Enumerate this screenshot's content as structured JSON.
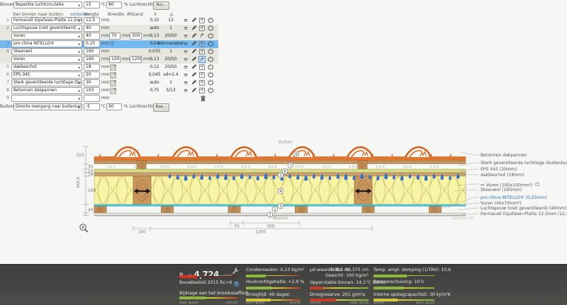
{
  "inside": {
    "label": "Binnen:",
    "condition": "Beperkte luchtcirculatie",
    "temp": "15",
    "temp_unit": "°C",
    "humidity": "80",
    "humidity_label": "% Luchtvochtigheid",
    "button": "Rsi..."
  },
  "outside": {
    "label": "Buiten:",
    "condition": "Directe overgang naar buitenlucht",
    "temp": "-5",
    "temp_unit": "°C",
    "humidity": "90",
    "humidity_label": "% Luchtvochtigheid",
    "button": "Rse..."
  },
  "table_header": {
    "direction": "Van binnen naar buiten:",
    "invert_link": "omkeren",
    "hoogte": "Hoogte",
    "breedte": "Breedte",
    "afstand": "Afstand",
    "lambda": "λ",
    "mu": "μ"
  },
  "units": {
    "mm": "mm"
  },
  "layers": [
    {
      "num": "1",
      "name": "Fermacell Gipsfaser-Platte 12,5mm",
      "hoogte": "12,5",
      "lambda": "0,32",
      "mu": "13"
    },
    {
      "num": "2",
      "name": "Luchtspouw (niet geventileerd)",
      "hoogte": "40",
      "lambda": "auto",
      "mu": "1",
      "group": true
    },
    {
      "num": "",
      "name": "Vuren",
      "hoogte": "40",
      "breedte": "70",
      "afstand": "300",
      "lambda": "0,13",
      "mu": "20/50",
      "group": true,
      "sub": true
    },
    {
      "num": "3",
      "name": "pro clima INTELLO®",
      "hoogte": "0,25",
      "lambda": "0,04",
      "mu": "sd=variabel",
      "selected": true,
      "foil": true
    },
    {
      "num": "4",
      "name": "Steenwol",
      "hoogte": "160",
      "lambda": "0,035",
      "mu": "1",
      "group": true
    },
    {
      "num": "",
      "name": "Vuren",
      "hoogte": "160",
      "breedte": "100",
      "afstand": "1200",
      "lambda": "0,13",
      "mu": "20/50",
      "group": true,
      "sub": true,
      "sub_selected": true
    },
    {
      "num": "5",
      "name": "dakbeschot",
      "hoogte": "18",
      "lambda": "0,12",
      "mu": "20/50",
      "swatch": true
    },
    {
      "num": "6",
      "name": "EPS 045",
      "hoogte": "20",
      "lambda": "0,045",
      "mu": "sd=2.4",
      "swatch": true
    },
    {
      "num": "7",
      "name": "Sterk geventileerde luchtlage (buitenlucht)",
      "hoogte": "30",
      "lambda": "auto",
      "mu": "1",
      "swatch": true
    },
    {
      "num": "8",
      "name": "Betonnen dakpannen",
      "hoogte": "103",
      "lambda": "0,75",
      "mu": "5/13",
      "swatch": true
    },
    {
      "num": "9",
      "name": "",
      "hoogte": "",
      "empty": true
    }
  ],
  "diagram": {
    "buiten": "Buiten",
    "binnen": "Binnen",
    "watermark": "ubakus.de",
    "total_thickness": "383,8",
    "dims_left": [
      "103",
      "30",
      "20",
      "18",
      "160",
      "40"
    ],
    "dims_top_row": [
      "70",
      "300"
    ],
    "dims_bottom_row": [
      "100",
      "1200"
    ],
    "markers": [
      "1",
      "2",
      "3",
      "4",
      "5",
      "6",
      "7",
      "8"
    ],
    "legend": [
      {
        "label": "Betonnen dakpannen"
      },
      {
        "label": "Sterk geventileerde luchtlage (buitenlucht) (30mm)"
      },
      {
        "label": "EPS 045 (20mm)"
      },
      {
        "label": "dakbeschot (18mm)"
      },
      {
        "label": "Vuren (160x100mm²)",
        "prefix": "↔",
        "power": true
      },
      {
        "label": "Steenwol (160mm)"
      },
      {
        "label": "pro clima INTELLO® (0,25mm)",
        "color": "#2a6ebb"
      },
      {
        "label": "Vuren (40x70mm²)"
      },
      {
        "label": "Luchtspouw (niet geventileerd) (40mm)"
      },
      {
        "label": "Fermacell Gipsfaser-Platte 12,5mm (12,5mm)"
      }
    ]
  },
  "footer": {
    "rc_sym": "R",
    "rc_sub": "c",
    "rc_eq": " = ",
    "rc_value": "4,724",
    "rc_unit": " m²K/W",
    "rc_bar": {
      "fill": 30,
      "color": "#dd2f1e",
      "track": "#5e2e28"
    },
    "bouwbesluit": "Bouwbesluit 2015 Rc>6",
    "info_glyph": "?",
    "col_a_metric": {
      "label": "Bijdrage aan het broeikaseffect",
      "fill": 45,
      "color": "#8db83e"
    },
    "col_b": [
      {
        "label": "Condenswater: 0,23 kg/m²",
        "fill": 36,
        "color": "#8db83e"
      },
      {
        "label": "Houtvochtgehalte: +2,9 %",
        "fill": 48,
        "color": "#8db83e"
      },
      {
        "label": "Droogtijd: 49 dagen",
        "fill": 45,
        "color": "#d6c83a"
      }
    ],
    "col_c_left": "µd-waarde: 8,1 m",
    "col_c_right1": "Dikte: 38,375 cm",
    "col_c_right2": "Gewicht: 100 kg/m²",
    "col_c": [
      {
        "label": "Oppervlakte binnen: 14,1°C (85%)",
        "fill": 22,
        "color": "#c63b28"
      },
      {
        "label": "Droogreserve: 201 g/m²a",
        "fill": 45,
        "color": "#c63b28"
      }
    ],
    "col_d": [
      {
        "label": "Temp. ampl. demping (1/TAV): 10,6",
        "fill": 55,
        "color": "#8db83e"
      },
      {
        "label": "Faseverschuiving: 10 h",
        "fill": 50,
        "color": "#8db83e"
      },
      {
        "label": "Interne opslagcapaciteit: 30 kJ/m²K",
        "fill": 40,
        "color": "#d6c83a"
      }
    ],
    "scale_good": "zeer goed",
    "scale_bad": "slecht"
  }
}
